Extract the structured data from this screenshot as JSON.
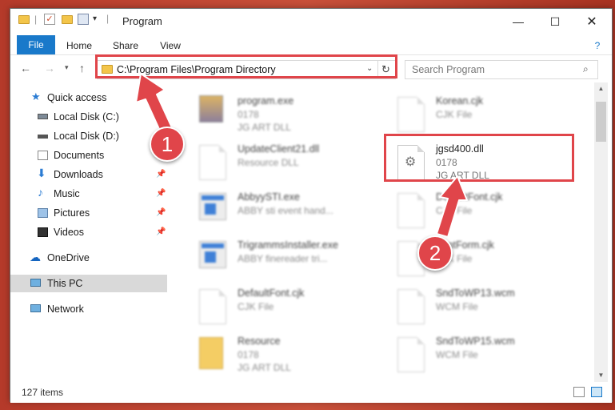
{
  "window": {
    "title": "Program"
  },
  "ribbon": {
    "tabs": [
      {
        "label": "File"
      },
      {
        "label": "Home"
      },
      {
        "label": "Share"
      },
      {
        "label": "View"
      }
    ]
  },
  "address": {
    "path": "C:\\Program Files\\Program Directory"
  },
  "search": {
    "placeholder": "Search Program"
  },
  "nav": {
    "quick_access": "Quick access",
    "items": [
      {
        "label": "Local Disk (C:)"
      },
      {
        "label": "Local Disk (D:)"
      },
      {
        "label": "Documents"
      },
      {
        "label": "Downloads"
      },
      {
        "label": "Music"
      },
      {
        "label": "Pictures"
      },
      {
        "label": "Videos"
      }
    ],
    "onedrive": "OneDrive",
    "thispc": "This PC",
    "network": "Network"
  },
  "files": {
    "left": [
      {
        "name": "program.exe",
        "sub1": "0178",
        "sub2": "JG ART DLL"
      },
      {
        "name": "UpdateClient21.dll",
        "sub1": "Resource DLL",
        "sub2": ""
      },
      {
        "name": "AbbyySTI.exe",
        "sub1": "ABBY sti event hand...",
        "sub2": ""
      },
      {
        "name": "TrigrammsInstaller.exe",
        "sub1": "ABBY finereader tri...",
        "sub2": ""
      },
      {
        "name": "DefaultFont.cjk",
        "sub1": "CJK File",
        "sub2": ""
      },
      {
        "name": "Resource",
        "sub1": "0178",
        "sub2": "JG ART DLL"
      }
    ],
    "right": [
      {
        "name": "Korean.cjk",
        "sub1": "CJK File",
        "sub2": ""
      },
      {
        "name": "jgsd400.dll",
        "sub1": "0178",
        "sub2": "JG ART DLL"
      },
      {
        "name": "DefaultFont.cjk",
        "sub1": "CJK File",
        "sub2": ""
      },
      {
        "name": "FontForm.cjk",
        "sub1": "CJK File",
        "sub2": ""
      },
      {
        "name": "SndToWP13.wcm",
        "sub1": "WCM File",
        "sub2": ""
      },
      {
        "name": "SndToWP15.wcm",
        "sub1": "WCM File",
        "sub2": ""
      }
    ]
  },
  "status": {
    "count": "127 items"
  },
  "annotations": {
    "badge1": "1",
    "badge2": "2",
    "color": "#e0454a"
  }
}
